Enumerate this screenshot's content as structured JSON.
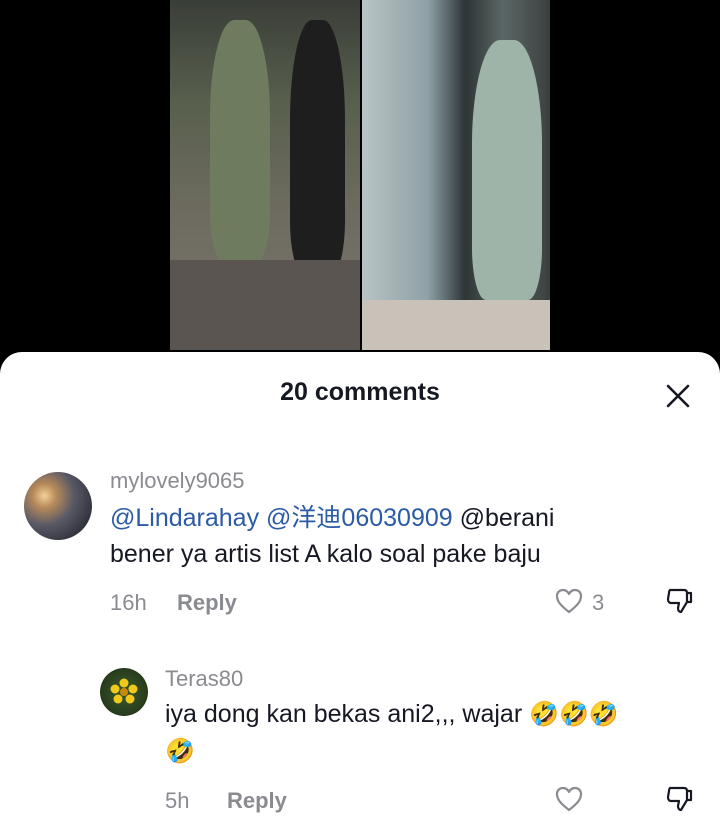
{
  "header": {
    "title": "20 comments"
  },
  "comments": [
    {
      "username": "mylovely9065",
      "mention1": "@Lindarahay",
      "mention2": "@洋迪06030909",
      "text_line1_rest": " @berani",
      "text_line2": "bener ya artis list A kalo soal pake baju",
      "time": "16h",
      "reply_label": "Reply",
      "like_count": "3"
    },
    {
      "username": "Teras80",
      "text_line1": "iya dong kan bekas ani2,,, wajar ",
      "emoji": "🤣",
      "time": "5h",
      "reply_label": "Reply"
    }
  ],
  "colors": {
    "mention": "#2b5aa6",
    "meta": "#8a8b91",
    "text": "#161823"
  }
}
